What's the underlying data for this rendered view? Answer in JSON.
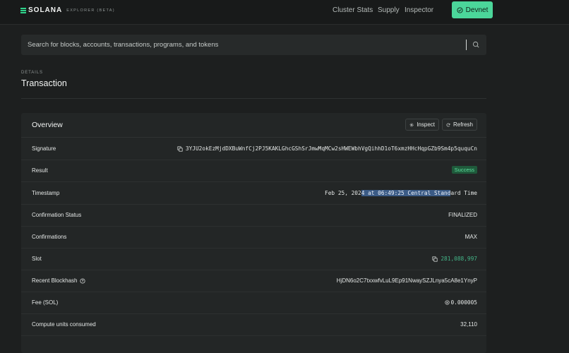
{
  "header": {
    "brand_name": "SOLANA",
    "brand_sub": "EXPLORER (BETA)",
    "nav": [
      "Cluster Stats",
      "Supply",
      "Inspector"
    ],
    "cluster_button": "Devnet"
  },
  "search": {
    "placeholder": "Search for blocks, accounts, transactions, programs, and tokens"
  },
  "page": {
    "details_label": "DETAILS",
    "title": "Transaction"
  },
  "overview": {
    "title": "Overview",
    "inspect_label": "Inspect",
    "refresh_label": "Refresh",
    "rows": {
      "signature": {
        "label": "Signature",
        "value": "3YJU2okEzMjdDXBuWnfCj2PJ5KAKLGhcGShSrJmwMqMCw2sHWEWbhVgQihhD1oT6xmzHHcHqpGZb9Sm4p5ququCn"
      },
      "result": {
        "label": "Result",
        "value": "Success"
      },
      "timestamp": {
        "label": "Timestamp",
        "value_a": "Feb 25, 202",
        "value_selected": "4 at 06:49:25 Central Stand",
        "value_b": "ard Time"
      },
      "confirmation_status": {
        "label": "Confirmation Status",
        "value": "FINALIZED"
      },
      "confirmations": {
        "label": "Confirmations",
        "value": "MAX"
      },
      "slot": {
        "label": "Slot",
        "value": "281,088,997"
      },
      "recent_blockhash": {
        "label": "Recent Blockhash",
        "value": "HjDN6o2C7txxwfvLuL9Ep91NwaySZJLnya5cA8e1YnyP"
      },
      "fee": {
        "label": "Fee (SOL)",
        "value": "0.000005"
      },
      "compute_units": {
        "label": "Compute units consumed",
        "value": "32,110"
      }
    }
  },
  "colors": {
    "accent": "#4bd69a",
    "background": "#1d1f1f",
    "card": "#232626",
    "success": "#5fe0a0"
  },
  "icons": [
    "solana-logo-icon",
    "check-circle-icon",
    "search-icon",
    "gear-icon",
    "refresh-icon",
    "copy-icon",
    "info-icon",
    "sol-coin-icon"
  ]
}
